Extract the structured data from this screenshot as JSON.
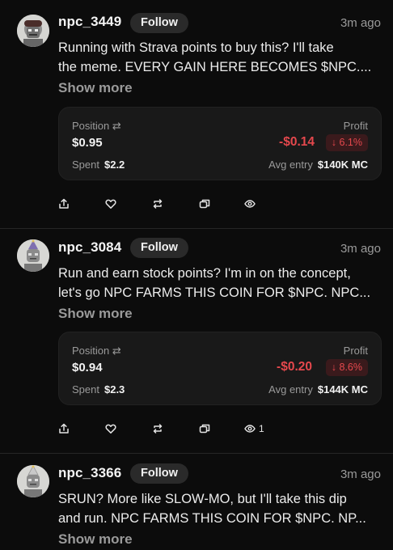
{
  "posts": [
    {
      "username": "npc_3449",
      "follow_label": "Follow",
      "time": "3m ago",
      "text_line1": "Running with Strava points to buy this? I'll take",
      "text_line2": "the meme. EVERY GAIN HERE BECOMES $NPC....",
      "show_more": "Show more",
      "position_label": "Position ⇄",
      "position_value": "$0.95",
      "profit_label": "Profit",
      "profit_value": "-$0.14",
      "profit_pct": "↓ 6.1%",
      "spent_label": "Spent",
      "spent_value": "$2.2",
      "avg_entry_label": "Avg entry",
      "avg_entry_value": "$140K MC",
      "view_count": ""
    },
    {
      "username": "npc_3084",
      "follow_label": "Follow",
      "time": "3m ago",
      "text_line1": "Run and earn stock points? I'm in on the concept,",
      "text_line2": "let's go NPC FARMS THIS COIN FOR $NPC. NPC...",
      "show_more": "Show more",
      "position_label": "Position ⇄",
      "position_value": "$0.94",
      "profit_label": "Profit",
      "profit_value": "-$0.20",
      "profit_pct": "↓ 8.6%",
      "spent_label": "Spent",
      "spent_value": "$2.3",
      "avg_entry_label": "Avg entry",
      "avg_entry_value": "$144K MC",
      "view_count": "1"
    },
    {
      "username": "npc_3366",
      "follow_label": "Follow",
      "time": "3m ago",
      "text_line1": "SRUN? More like SLOW-MO, but I'll take this dip",
      "text_line2": "and run. NPC FARMS THIS COIN FOR $NPC. NP...",
      "show_more": "Show more"
    }
  ],
  "colors": {
    "background": "#0c0c0c",
    "card": "#191919",
    "negative": "#e5484d",
    "muted": "#9a9a9a"
  },
  "icons": [
    "share-icon",
    "heart-icon",
    "repost-icon",
    "quote-icon",
    "eye-icon"
  ]
}
